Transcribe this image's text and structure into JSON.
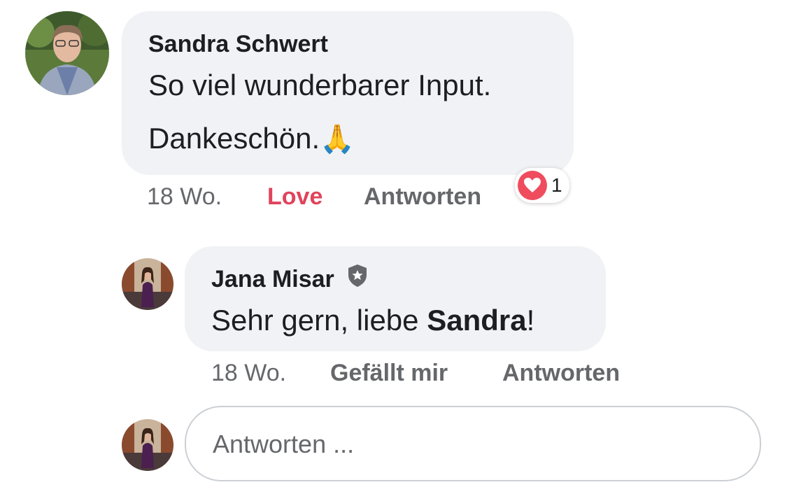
{
  "comment": {
    "author": "Sandra Schwert",
    "text_line1": "So viel wunderbarer Input.",
    "text_line2": "Dankeschön.",
    "emoji": "🙏",
    "time": "18 Wo.",
    "love_label": "Love",
    "reply_label": "Antworten",
    "reaction_count": "1",
    "reaction_icon": "heart-icon"
  },
  "reply": {
    "author": "Jana Misar",
    "badge_icon": "shield-star-icon",
    "text_before": "Sehr gern, liebe ",
    "mention": "Sandra",
    "text_after": "!",
    "time": "18 Wo.",
    "like_label": "Gefällt mir",
    "reply_label": "Antworten"
  },
  "composer": {
    "placeholder": "Antworten ..."
  },
  "colors": {
    "bubble": "#f0f2f5",
    "love": "#e0445c",
    "meta": "#65676b"
  }
}
